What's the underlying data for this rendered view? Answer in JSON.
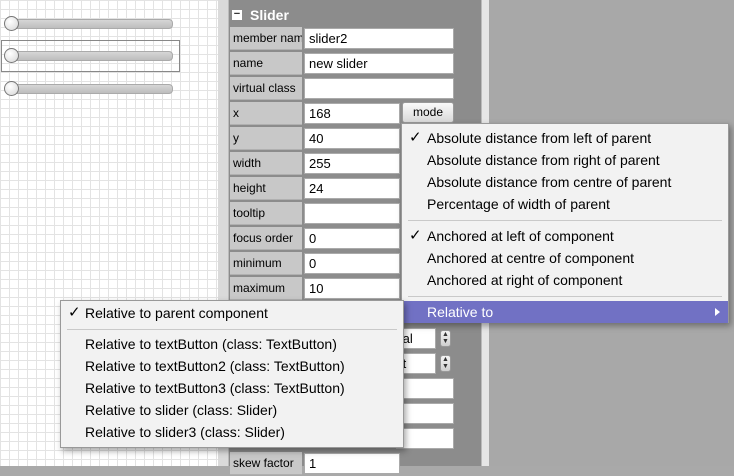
{
  "section": {
    "title": "Slider"
  },
  "properties": [
    {
      "label": "member name",
      "value": "slider2"
    },
    {
      "label": "name",
      "value": "new slider"
    },
    {
      "label": "virtual class",
      "value": ""
    },
    {
      "label": "x",
      "value": "168"
    },
    {
      "label": "y",
      "value": "40"
    },
    {
      "label": "width",
      "value": "255"
    },
    {
      "label": "height",
      "value": "24"
    },
    {
      "label": "tooltip",
      "value": ""
    },
    {
      "label": "focus order",
      "value": "0"
    },
    {
      "label": "minimum",
      "value": "0"
    },
    {
      "label": "maximum",
      "value": "10"
    },
    {
      "label": "skew factor",
      "value": "1"
    }
  ],
  "mode_button": {
    "label": "mode"
  },
  "mode_menu": {
    "distance_items": [
      {
        "label": "Absolute distance from left of parent",
        "checked": true
      },
      {
        "label": "Absolute distance from right of parent",
        "checked": false
      },
      {
        "label": "Absolute distance from centre of parent",
        "checked": false
      },
      {
        "label": "Percentage of width of parent",
        "checked": false
      }
    ],
    "anchor_items": [
      {
        "label": "Anchored at left of component",
        "checked": true
      },
      {
        "label": "Anchored at centre of component",
        "checked": false
      },
      {
        "label": "Anchored at right of component",
        "checked": false
      }
    ],
    "relative_to": {
      "label": "Relative to",
      "highlighted": true
    }
  },
  "relative_menu": {
    "parent_item": {
      "label": "Relative to parent component",
      "checked": true
    },
    "items": [
      {
        "label": "Relative to textButton (class: TextButton)"
      },
      {
        "label": "Relative to textButton2 (class: TextButton)"
      },
      {
        "label": "Relative to textButton3 (class: TextButton)"
      },
      {
        "label": "Relative to slider (class: Slider)"
      },
      {
        "label": "Relative to slider3 (class: Slider)"
      }
    ]
  },
  "partial_fields": {
    "style_fragment": "tal",
    "text_pos_fragment": "ft"
  },
  "colors": {
    "menu_highlight": "#7171c4",
    "panel_bg": "#8c8c8c",
    "label_bg": "#c8c8c8"
  }
}
